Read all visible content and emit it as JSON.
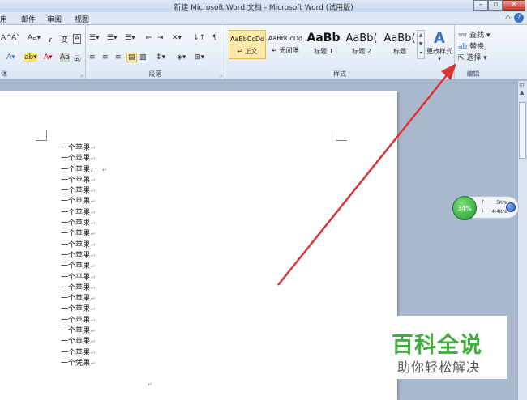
{
  "window": {
    "title": "新建 Microsoft Word 文档 - Microsoft Word (试用版)",
    "min": "–",
    "max": "▫",
    "close": "✕"
  },
  "tabs": [
    "用",
    "邮件",
    "审阅",
    "视图"
  ],
  "minimize_ribbon": "△",
  "help": "?",
  "ribbon": {
    "font_group_label": "体",
    "paragraph_group_label": "段落",
    "styles_group_label": "样式",
    "editing_group_label": "编辑",
    "font_row1": [
      "A^",
      "A˅",
      "Aa▾",
      "ꭉ",
      "变",
      "A"
    ],
    "font_row2": [
      "A▾",
      "ab▾",
      "A▾",
      "Aa",
      "㊄"
    ],
    "para_row1": [
      "☰▾",
      "☰▾",
      "☰▾",
      "⇤",
      "⇥",
      "✕▾",
      "↓↑",
      "¶"
    ],
    "para_row2": [
      "≡",
      "≡",
      "≡",
      "▤",
      "▥",
      "↕▾",
      "◈▾",
      "⊞▾"
    ],
    "styles": [
      {
        "preview": "AaBbCcDd",
        "name": "↵ 正文",
        "size": "small",
        "selected": true
      },
      {
        "preview": "AaBbCcDd",
        "name": "↵ 无间隔",
        "size": "small",
        "selected": false
      },
      {
        "preview": "AaBb",
        "name": "标题 1",
        "size": "big",
        "selected": false
      },
      {
        "preview": "AaBb(",
        "name": "标题 2",
        "size": "mid",
        "selected": false
      },
      {
        "preview": "AaBb(",
        "name": "标题",
        "size": "mid",
        "selected": false
      }
    ],
    "change_styles": "更改样式",
    "find": "查找 ▾",
    "replace": "替换",
    "select": "选择 ▾",
    "accent_color": "#e8b84a"
  },
  "document": {
    "lines": [
      "一个苹果",
      "一个苹果",
      "一个苹果，",
      "一个苹果",
      "一个苹果",
      "一个苹果",
      "一个苹果",
      "一个苹果",
      "一个苹果",
      "一个苹果",
      "一个苹果",
      "一个苹果",
      "一个平果",
      "一个苹果",
      "一个苹果",
      "一个苹果",
      "一个苹果",
      "一个苹果",
      "一个苹果",
      "一个苹果",
      "一个凭果"
    ],
    "paragraph_mark": "↵"
  },
  "speed_widget": {
    "percent": "34%",
    "upload": "5K/s",
    "download": "4.4K/s"
  },
  "watermark": {
    "title": "百科全说",
    "subtitle": "助你轻松解决"
  },
  "annotation_color": "#e03131"
}
